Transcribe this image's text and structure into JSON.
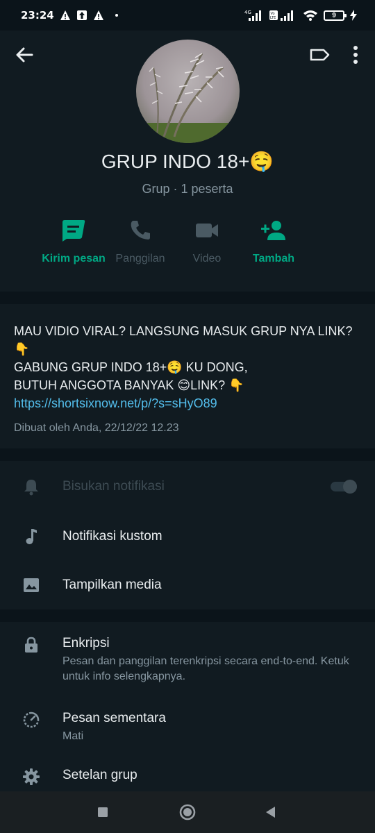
{
  "status_bar": {
    "time": "23:24",
    "network": "4G",
    "volte": "Vo LTE",
    "battery": "9"
  },
  "header": {
    "group_name": "GRUP INDO 18+🤤",
    "subtitle": "Grup · 1 peserta"
  },
  "actions": [
    {
      "label": "Kirim pesan",
      "icon": "message-icon"
    },
    {
      "label": "Panggilan",
      "icon": "phone-icon"
    },
    {
      "label": "Video",
      "icon": "video-icon"
    },
    {
      "label": "Tambah",
      "icon": "add-person-icon"
    }
  ],
  "description": {
    "text": "MAU VIDIO VIRAL? LANGSUNG MASUK GRUP NYA LINK? 👇\nGABUNG GRUP INDO 18+🤤 KU DONG,\nBUTUH ANGGOTA BANYAK 😊LINK? 👇",
    "link": "https://shortsixnow.net/p/?s=sHyO89",
    "meta": "Dibuat oleh Anda, 22/12/22 12.23"
  },
  "settings": {
    "mute": {
      "title": "Bisukan notifikasi",
      "enabled": false
    },
    "custom_notif": {
      "title": "Notifikasi kustom"
    },
    "media": {
      "title": "Tampilkan media"
    },
    "encryption": {
      "title": "Enkripsi",
      "subtitle": "Pesan dan panggilan terenkripsi secara end-to-end. Ketuk untuk info selengkapnya."
    },
    "disappearing": {
      "title": "Pesan sementara",
      "subtitle": "Mati"
    },
    "group_settings": {
      "title": "Setelan grup"
    }
  },
  "colors": {
    "accent": "#00a884",
    "background": "#0b141a",
    "panel": "#111b21",
    "link": "#53bdeb"
  }
}
